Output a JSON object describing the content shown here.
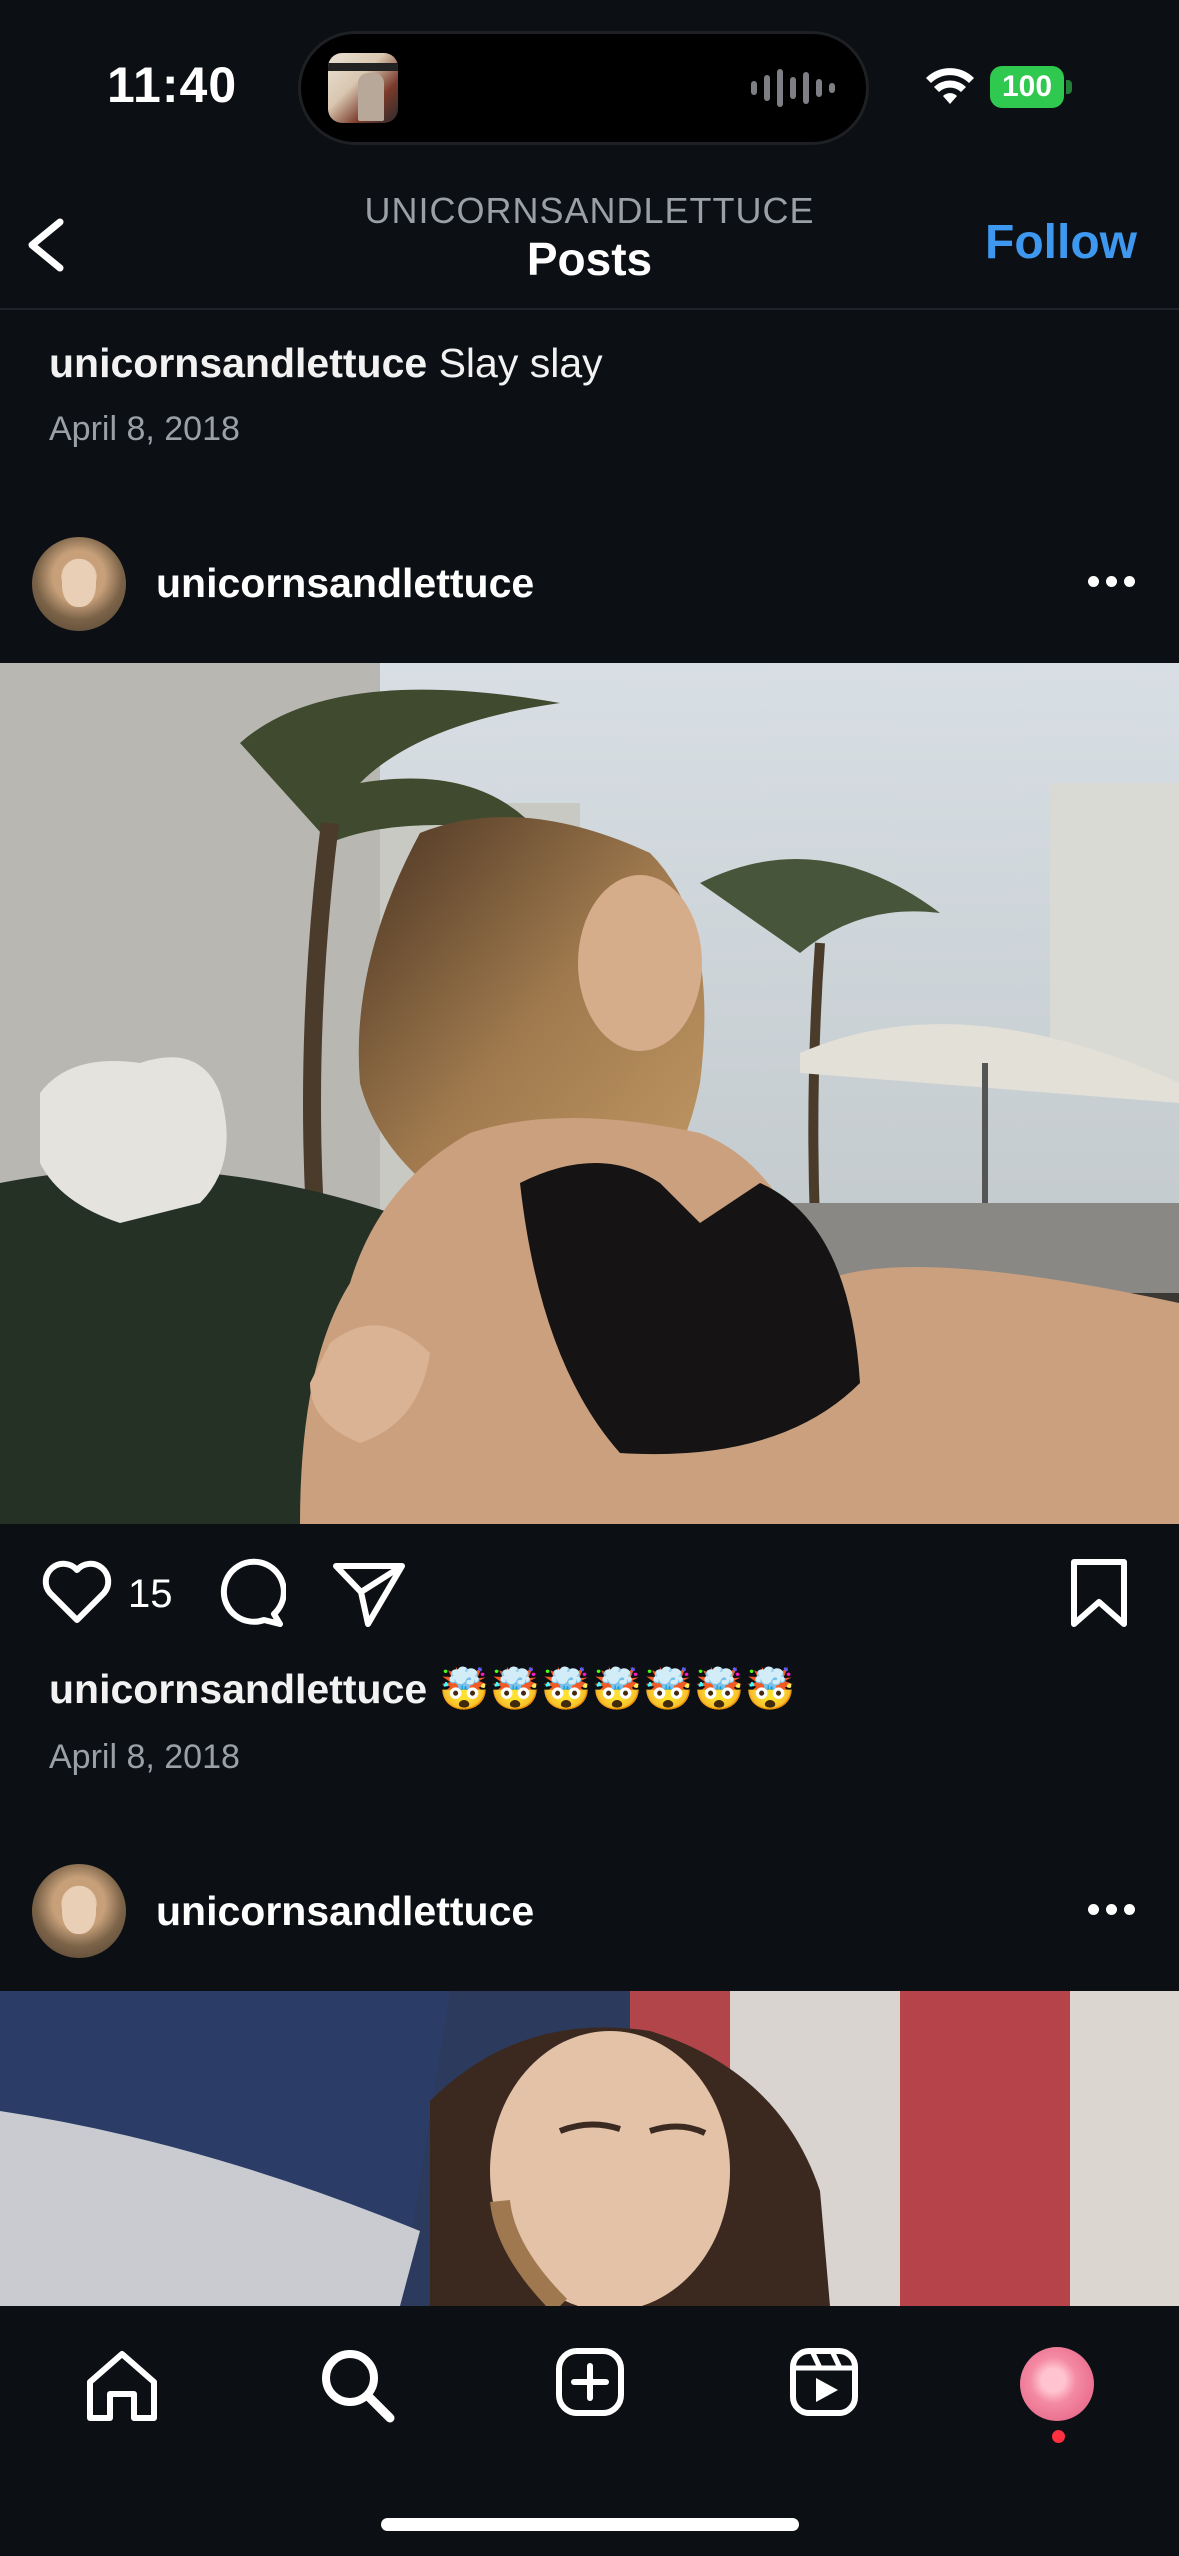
{
  "status_bar": {
    "time": "11:40",
    "battery": "100"
  },
  "header": {
    "subtitle": "UNICORNSANDLETTUCE",
    "title": "Posts",
    "follow_label": "Follow"
  },
  "previous_post": {
    "username": "unicornsandlettuce",
    "caption": "Slay slay",
    "date": "April 8, 2018"
  },
  "post1": {
    "username": "unicornsandlettuce",
    "likes": "15",
    "caption_username": "unicornsandlettuce",
    "caption_text": "🤯🤯🤯🤯🤯🤯🤯",
    "date": "April 8, 2018"
  },
  "post2": {
    "username": "unicornsandlettuce"
  },
  "icons": {
    "back": "chevron-left-icon",
    "more": "more-horizontal-icon",
    "like": "heart-icon",
    "comment": "comment-icon",
    "share": "send-icon",
    "save": "bookmark-icon",
    "home": "home-icon",
    "search": "search-icon",
    "create": "add-square-icon",
    "reels": "reels-icon"
  },
  "colors": {
    "accent": "#3f98f0",
    "background": "#0c0f14",
    "battery": "#30c94f",
    "notification": "#ff3040"
  }
}
